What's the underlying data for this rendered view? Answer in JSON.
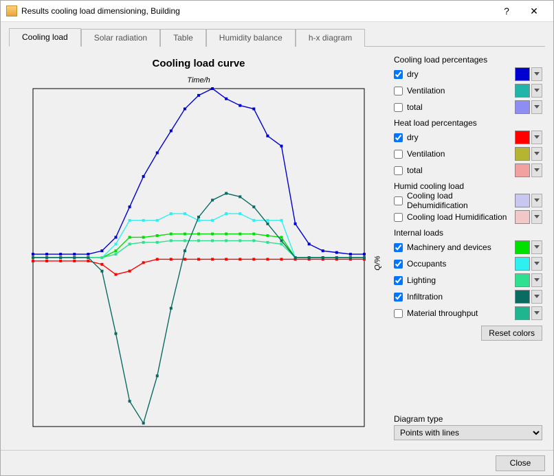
{
  "window": {
    "title": "Results cooling load dimensioning, Building",
    "help": "?",
    "close_glyph": "✕"
  },
  "tabs": [
    {
      "label": "Cooling load",
      "active": true
    },
    {
      "label": "Solar radiation",
      "active": false
    },
    {
      "label": "Table",
      "active": false
    },
    {
      "label": "Humidity balance",
      "active": false
    },
    {
      "label": "h-x diagram",
      "active": false
    }
  ],
  "chart": {
    "title": "Cooling load curve",
    "x_axis_label": "Time/h",
    "y_axis_label": "Q/%"
  },
  "legend": {
    "groups": [
      {
        "title": "Cooling load percentages",
        "items": [
          {
            "label": "dry",
            "checked": true,
            "color": "#0000d0"
          },
          {
            "label": "Ventilation",
            "checked": false,
            "color": "#1fb5a8"
          },
          {
            "label": "total",
            "checked": false,
            "color": "#8d8df2"
          }
        ]
      },
      {
        "title": "Heat load percentages",
        "items": [
          {
            "label": "dry",
            "checked": true,
            "color": "#ff0000"
          },
          {
            "label": "Ventilation",
            "checked": false,
            "color": "#b5b531"
          },
          {
            "label": "total",
            "checked": false,
            "color": "#f2a0a0"
          }
        ]
      },
      {
        "title": "Humid cooling load",
        "items": [
          {
            "label": "Cooling load Dehumidification",
            "checked": false,
            "color": "#c7c7f2"
          },
          {
            "label": "Cooling load Humidification",
            "checked": false,
            "color": "#f2c7c7"
          }
        ]
      },
      {
        "title": "Internal loads",
        "items": [
          {
            "label": "Machinery and devices",
            "checked": true,
            "color": "#00e000"
          },
          {
            "label": "Occupants",
            "checked": true,
            "color": "#2ef0f0"
          },
          {
            "label": "Lighting",
            "checked": true,
            "color": "#2ee090"
          },
          {
            "label": "Infiltration",
            "checked": true,
            "color": "#0a6b63"
          },
          {
            "label": "Material throughput",
            "checked": false,
            "color": "#1fb58f"
          }
        ]
      }
    ],
    "reset_label": "Reset colors"
  },
  "diagram_type": {
    "label": "Diagram type",
    "selected": "Points with lines"
  },
  "footer": {
    "close_label": "Close"
  },
  "chart_data": {
    "type": "line",
    "xlabel": "Time/h",
    "ylabel": "Q/%",
    "x": [
      0,
      1,
      2,
      3,
      4,
      5,
      6,
      7,
      8,
      9,
      10,
      11,
      12,
      13,
      14,
      15,
      16,
      17,
      18,
      19,
      20,
      21,
      22,
      23,
      24
    ],
    "ylim": [
      -100,
      100
    ],
    "baseline_y": 0,
    "series": [
      {
        "name": "Cooling dry",
        "color": "#0000d0",
        "values": [
          2,
          2,
          2,
          2,
          2,
          4,
          12,
          30,
          48,
          62,
          75,
          88,
          96,
          100,
          94,
          90,
          88,
          72,
          66,
          20,
          8,
          4,
          3,
          2,
          2
        ]
      },
      {
        "name": "Heat dry",
        "color": "#ff0000",
        "values": [
          -2,
          -2,
          -2,
          -2,
          -2,
          -4,
          -10,
          -8,
          -3,
          -1,
          -1,
          -1,
          -1,
          -1,
          -1,
          -1,
          -1,
          -1,
          -1,
          -1,
          -1,
          -1,
          -1,
          -1,
          -1
        ]
      },
      {
        "name": "Machinery and devices",
        "color": "#00e000",
        "values": [
          0,
          0,
          0,
          0,
          0,
          0,
          4,
          12,
          12,
          13,
          14,
          14,
          14,
          14,
          14,
          14,
          14,
          13,
          12,
          0,
          0,
          0,
          0,
          0,
          0
        ]
      },
      {
        "name": "Occupants",
        "color": "#2ef0f0",
        "values": [
          0,
          0,
          0,
          0,
          0,
          0,
          8,
          22,
          22,
          22,
          26,
          26,
          22,
          22,
          26,
          26,
          22,
          22,
          22,
          0,
          0,
          0,
          0,
          0,
          0
        ]
      },
      {
        "name": "Lighting",
        "color": "#2ee090",
        "values": [
          0,
          0,
          0,
          0,
          0,
          0,
          2,
          8,
          9,
          9,
          10,
          10,
          10,
          10,
          10,
          10,
          10,
          9,
          8,
          0,
          0,
          0,
          0,
          0,
          0
        ]
      },
      {
        "name": "Infiltration",
        "color": "#0a6b63",
        "values": [
          0,
          0,
          0,
          0,
          0,
          -8,
          -45,
          -85,
          -98,
          -70,
          -30,
          4,
          24,
          34,
          38,
          36,
          30,
          20,
          10,
          0,
          0,
          0,
          0,
          0,
          0
        ]
      }
    ]
  }
}
